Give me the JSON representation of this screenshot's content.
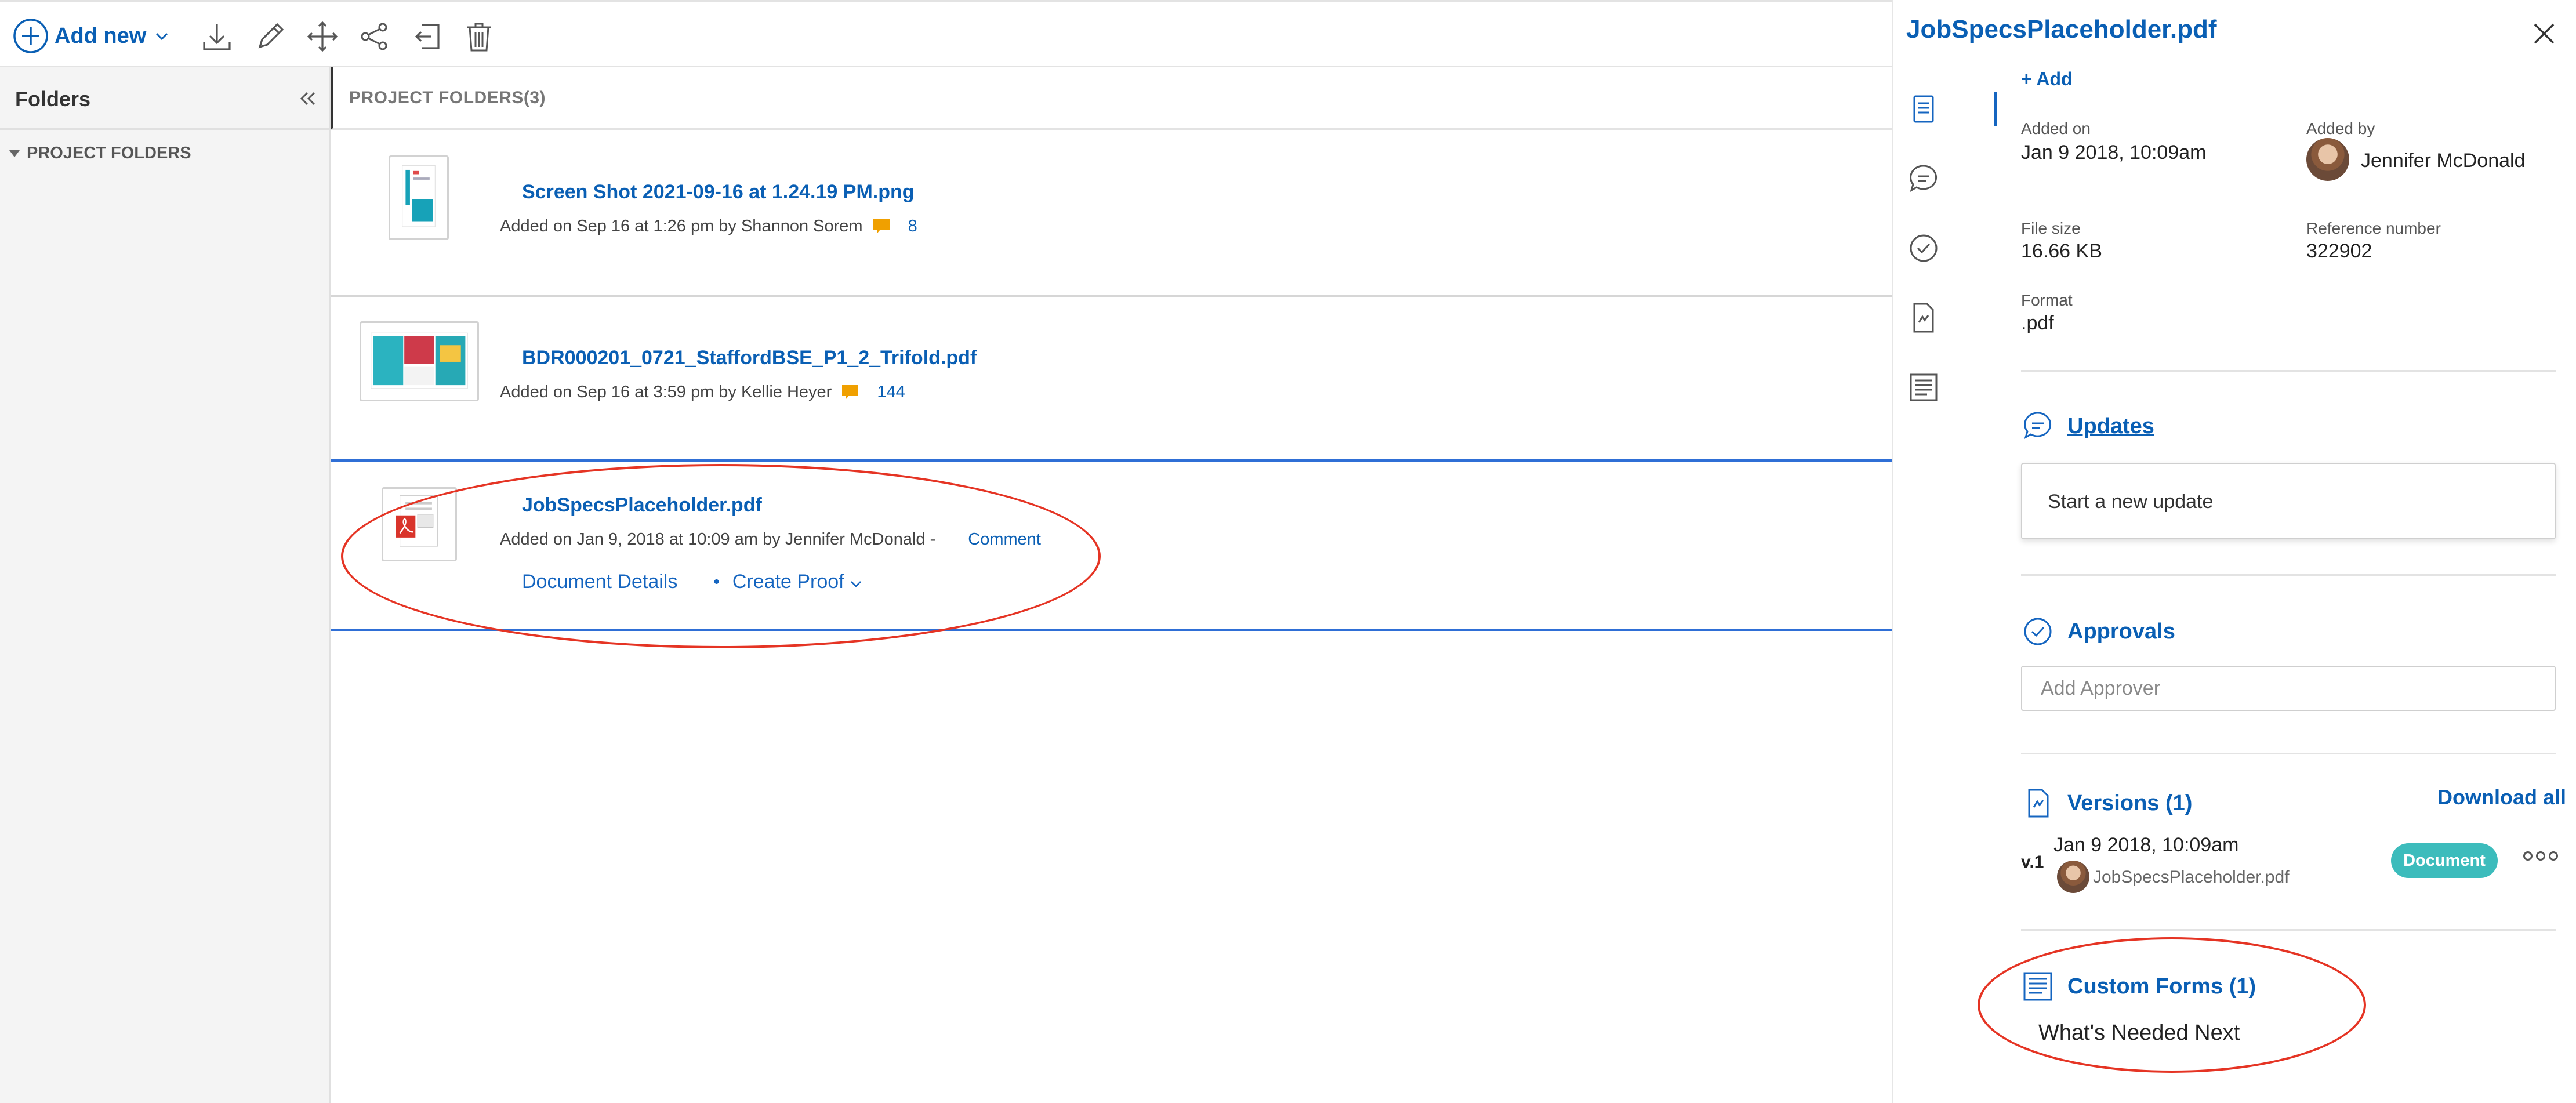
{
  "toolbar": {
    "add_new_label": "Add new",
    "icons": [
      "download-icon",
      "pencil-icon",
      "move-icon",
      "share-icon",
      "move-to-icon",
      "trash-icon"
    ]
  },
  "sidebar": {
    "title": "Folders",
    "tree": [
      {
        "label": "PROJECT FOLDERS",
        "expanded": true
      }
    ]
  },
  "main": {
    "header": "PROJECT FOLDERS(3)",
    "files": [
      {
        "name": "Screen Shot 2021-09-16 at 1.24.19 PM.png",
        "meta": "Added on Sep 16 at 1:26 pm by Shannon Sorem",
        "comment_count": "8"
      },
      {
        "name": "BDR000201_0721_StaffordBSE_P1_2_Trifold.pdf",
        "meta": "Added on Sep 16 at 3:59 pm by Kellie Heyer",
        "comment_count": "144"
      },
      {
        "name": "JobSpecsPlaceholder.pdf",
        "meta": "Added on Jan 9, 2018 at 10:09 am by Jennifer McDonald -",
        "comment_link": "Comment",
        "actions": {
          "details": "Document Details",
          "separator": "•",
          "create_proof": "Create Proof"
        }
      }
    ]
  },
  "panel": {
    "title": "JobSpecsPlaceholder.pdf",
    "add_label": "+ Add",
    "details": {
      "added_on_label": "Added on",
      "added_on": "Jan 9 2018, 10:09am",
      "added_by_label": "Added by",
      "added_by": "Jennifer  McDonald",
      "file_size_label": "File size",
      "file_size": "16.66 KB",
      "reference_label": "Reference number",
      "reference": "322902",
      "format_label": "Format",
      "format": ".pdf"
    },
    "updates": {
      "title": "Updates",
      "placeholder": "Start a new update"
    },
    "approvals": {
      "title": "Approvals",
      "placeholder": "Add Approver"
    },
    "versions": {
      "title": "Versions (1)",
      "download_all": "Download all",
      "items": [
        {
          "label": "v.1",
          "date": "Jan 9 2018, 10:09am",
          "file": "JobSpecsPlaceholder.pdf",
          "badge": "Document"
        }
      ]
    },
    "custom_forms": {
      "title": "Custom Forms (1)",
      "items": [
        "What's Needed Next"
      ]
    }
  },
  "colors": {
    "accent": "#0a5fb4",
    "selection": "#2f6fd6",
    "badge": "#3cbcbc",
    "annotation": "#e53424",
    "comment_bubble": "#f0a000"
  }
}
